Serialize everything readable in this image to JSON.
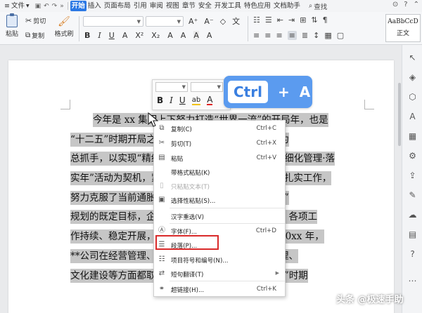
{
  "menubar": {
    "file": "文件",
    "tabs": [
      "开始",
      "插入",
      "页面布局",
      "引用",
      "审阅",
      "视图",
      "章节",
      "安全",
      "开发工具",
      "特色应用",
      "文档助手"
    ],
    "active_tab": "开始",
    "search": "查找"
  },
  "ribbon": {
    "paste": "粘贴",
    "cut": "剪切",
    "copy": "复制",
    "format_painter": "格式刷",
    "style_preview": "AaBbCcD",
    "style_name": "正文"
  },
  "document": {
    "lines": [
      {
        "plain": "",
        "hl": "今年是 xx 集团上下努力打造“世界一流”的开局年，也是",
        "first": true
      },
      {
        "plain": "",
        "hl": "“十二五”时期开局之年，集团公司围绕“十个转变”为"
      },
      {
        "plain": "",
        "hl": "总抓手，以实现“精细化管理”为目标，深入开展“精细化管理·落"
      },
      {
        "plain": "",
        "hl": "实年”活动为契机，紧紧围绕年度目标任务，务实，扎实工作，"
      },
      {
        "plain": "",
        "hl": "努力克服了当前通胀压力，全面超额完成了“十二五”"
      },
      {
        "plain": "",
        "hl": "规划的既定目标，企业继续保持了良好的发展态势，各项工"
      },
      {
        "plain": "",
        "hl": "作持续、稳定开展，取得了可喜的成绩，总的看，20xx 年，"
      },
      {
        "plain": "",
        "hl": "**公司在经营管理、财务管理、资产管理、内控管理、"
      },
      {
        "plain": "",
        "hl": "文化建设等方面都取得了新的成绩，实现了“十二五”时期"
      }
    ]
  },
  "shortcut": {
    "key1": "Ctrl",
    "plus": "+",
    "key2": "A"
  },
  "context_menu": [
    {
      "label": "复制(C)",
      "shortcut": "Ctrl+C",
      "icon": "copy-icon"
    },
    {
      "label": "剪切(T)",
      "shortcut": "Ctrl+X",
      "icon": "scissors-icon"
    },
    {
      "label": "粘贴",
      "shortcut": "Ctrl+V",
      "icon": "paste-icon"
    },
    {
      "label": "带格式粘贴(K)",
      "shortcut": "",
      "icon": ""
    },
    {
      "label": "只粘贴文本(T)",
      "shortcut": "",
      "icon": "",
      "disabled": true
    },
    {
      "label": "选择性粘贴(S)...",
      "shortcut": "",
      "icon": "paste-special-icon"
    },
    {
      "label": "汉字重选(V)",
      "shortcut": "",
      "icon": ""
    },
    {
      "label": "字体(F)...",
      "shortcut": "Ctrl+D",
      "icon": "font-icon"
    },
    {
      "label": "段落(P)...",
      "shortcut": "",
      "icon": "paragraph-icon"
    },
    {
      "label": "项目符号和编号(N)...",
      "shortcut": "",
      "icon": "list-icon"
    },
    {
      "label": "短句翻译(T)",
      "shortcut": "",
      "icon": "translate-icon",
      "submenu": true
    },
    {
      "label": "超链接(H)...",
      "shortcut": "Ctrl+K",
      "icon": "link-icon"
    }
  ],
  "watermark": "头条 @极速手助"
}
